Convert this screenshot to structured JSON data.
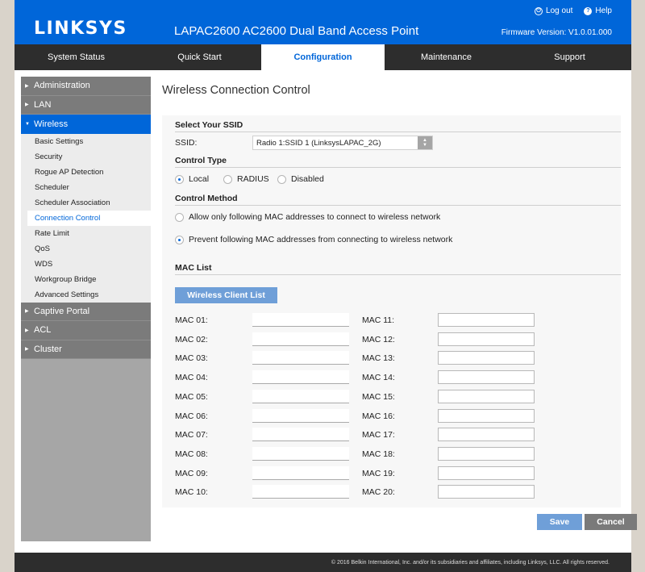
{
  "header": {
    "logo": "LINKSYS",
    "product": "LAPAC2600 AC2600 Dual Band Access Point",
    "logout": "Log out",
    "help": "Help",
    "firmware": "Firmware Version: V1.0.01.000"
  },
  "nav": {
    "tabs": [
      {
        "label": "System Status"
      },
      {
        "label": "Quick Start"
      },
      {
        "label": "Configuration",
        "active": true
      },
      {
        "label": "Maintenance"
      },
      {
        "label": "Support"
      }
    ]
  },
  "sidebar": {
    "administration": "Administration",
    "lan": "LAN",
    "wireless": "Wireless",
    "wireless_items": [
      "Basic Settings",
      "Security",
      "Rogue AP Detection",
      "Scheduler",
      "Scheduler Association",
      "Connection Control",
      "Rate Limit",
      "QoS",
      "WDS",
      "Workgroup Bridge",
      "Advanced Settings"
    ],
    "active_item": "Connection Control",
    "captive_portal": "Captive Portal",
    "acl": "ACL",
    "cluster": "Cluster"
  },
  "content": {
    "title": "Wireless Connection Control",
    "ssid_section": "Select Your SSID",
    "ssid_label": "SSID:",
    "ssid_value": "Radio 1:SSID 1 (LinksysLAPAC_2G)",
    "control_type_section": "Control Type",
    "control_type_options": [
      "Local",
      "RADIUS",
      "Disabled"
    ],
    "control_type_selected": "Local",
    "control_method_section": "Control Method",
    "control_method_allow": "Allow only following MAC addresses to connect to wireless network",
    "control_method_prevent": "Prevent following MAC addresses from connecting to wireless network",
    "control_method_selected": "prevent",
    "mac_list_section": "MAC List",
    "client_list_button": "Wireless Client List",
    "mac_labels": [
      "MAC 01:",
      "MAC 02:",
      "MAC 03:",
      "MAC 04:",
      "MAC 05:",
      "MAC 06:",
      "MAC 07:",
      "MAC 08:",
      "MAC 09:",
      "MAC 10:",
      "MAC 11:",
      "MAC 12:",
      "MAC 13:",
      "MAC 14:",
      "MAC 15:",
      "MAC 16:",
      "MAC 17:",
      "MAC 18:",
      "MAC 19:",
      "MAC 20:"
    ],
    "mac_values": [
      "",
      "",
      "",
      "",
      "",
      "",
      "",
      "",
      "",
      "",
      "",
      "",
      "",
      "",
      "",
      "",
      "",
      "",
      "",
      ""
    ]
  },
  "actions": {
    "save": "Save",
    "cancel": "Cancel"
  },
  "footer": {
    "copyright": "© 2016 Belkin International, Inc. and/or its subsidiaries and affiliates, including Linksys, LLC. All rights reserved."
  }
}
